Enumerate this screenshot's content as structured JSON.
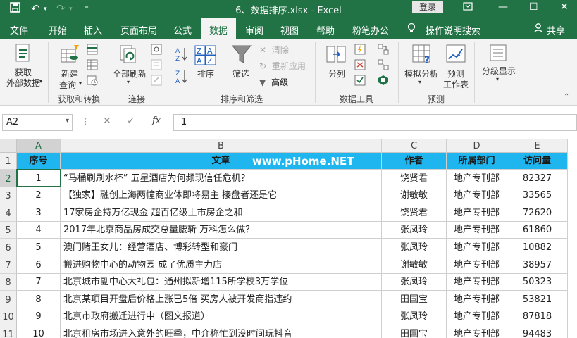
{
  "window": {
    "title": "6、数据排序.xlsx  -  Excel",
    "login_label": "登录"
  },
  "tabs": [
    {
      "label": "文件"
    },
    {
      "label": "开始"
    },
    {
      "label": "插入"
    },
    {
      "label": "页面布局"
    },
    {
      "label": "公式"
    },
    {
      "label": "数据"
    },
    {
      "label": "审阅"
    },
    {
      "label": "视图"
    },
    {
      "label": "帮助"
    },
    {
      "label": "粉笔办公"
    }
  ],
  "tell_me": "操作说明搜索",
  "share": "共享",
  "ribbon": {
    "get_data": "获取\n外部数据",
    "new_query_1": "新建",
    "new_query_2": "查询",
    "refresh_all": "全部刷新",
    "group_get_transform": "获取和转换",
    "group_connections": "连接",
    "sort": "排序",
    "filter": "筛选",
    "clear": "清除",
    "reapply": "重新应用",
    "advanced": "高级",
    "group_sort_filter": "排序和筛选",
    "text_to_columns": "分列",
    "group_data_tools": "数据工具",
    "what_if": "模拟分析",
    "forecast_sheet_1": "预测",
    "forecast_sheet_2": "工作表",
    "group_forecast": "预测",
    "outline": "分级显示"
  },
  "formula_bar": {
    "name_box": "A2",
    "value": "1"
  },
  "columns": [
    "A",
    "B",
    "C",
    "D",
    "E"
  ],
  "header_row": [
    "序号",
    "文章",
    "作者",
    "所属部门",
    "访问量"
  ],
  "watermark": "www.pHome.NET",
  "rows": [
    {
      "num": "2",
      "cells": [
        "1",
        "“马桶刷刷水杯” 五星酒店为何频现信任危机？",
        "饶贤君",
        "地产专刊部",
        "82327"
      ]
    },
    {
      "num": "3",
      "cells": [
        "2",
        "【独家】融创上海两幢商业体即将易主 接盘者还是它",
        "谢敏敏",
        "地产专刊部",
        "33565"
      ]
    },
    {
      "num": "4",
      "cells": [
        "3",
        "17家房企持万亿现金 超百亿级上市房企之和",
        "饶贤君",
        "地产专刊部",
        "72620"
      ]
    },
    {
      "num": "5",
      "cells": [
        "4",
        "2017年北京商品房成交总量腰斩 万科怎么做？",
        "张凤玲",
        "地产专刊部",
        "61860"
      ]
    },
    {
      "num": "6",
      "cells": [
        "5",
        "澳门赌王女儿：经营酒店、博彩转型和豪门",
        "张凤玲",
        "地产专刊部",
        "10882"
      ]
    },
    {
      "num": "7",
      "cells": [
        "6",
        "搬进购物中心的动物园 成了优质主力店",
        "谢敏敏",
        "地产专刊部",
        "38957"
      ]
    },
    {
      "num": "8",
      "cells": [
        "7",
        "北京城市副中心大礼包：通州拟新增115所学校3万学位",
        "张凤玲",
        "地产专刊部",
        "50323"
      ]
    },
    {
      "num": "9",
      "cells": [
        "8",
        "北京某项目开盘后价格上涨已5倍 买房人被开发商指违约",
        "田国宝",
        "地产专刊部",
        "53821"
      ]
    },
    {
      "num": "10",
      "cells": [
        "9",
        "北京市政府搬迁进行中（图文报道）",
        "张凤玲",
        "地产专刊部",
        "87818"
      ]
    },
    {
      "num": "11",
      "cells": [
        "10",
        "北京租房市场进入意外的旺季，中介称忙到没时间玩抖音",
        "田国宝",
        "地产专刊部",
        "94483"
      ]
    }
  ]
}
